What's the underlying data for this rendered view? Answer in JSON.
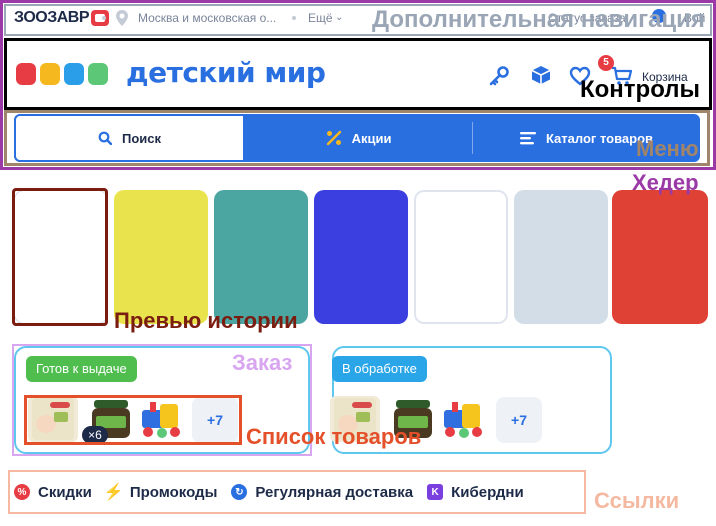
{
  "topbar": {
    "zoo_brand": "ЗООЗАВР",
    "location": "Москва и московская о...",
    "more": "Ещё",
    "right_text": "Статус заказа",
    "user_text": "Вой"
  },
  "header": {
    "brand_name": "детский мир",
    "brand_colors": [
      "#e83c45",
      "#f5b81e",
      "#2a9ee8",
      "#5cc777"
    ],
    "cart_count": "5",
    "cart_label": "Корзина"
  },
  "menu": {
    "items": [
      {
        "label": "Поиск",
        "icon": "search-icon"
      },
      {
        "label": "Акции",
        "icon": "percent-icon"
      },
      {
        "label": "Каталог товаров",
        "icon": "menu-icon"
      }
    ]
  },
  "stories": {
    "colors": [
      "#ffffff",
      "#e9e44e",
      "#4ba6a2",
      "#3c3fe0",
      "#ffffff",
      "#d3dde8",
      "#df4134"
    ]
  },
  "orders": [
    {
      "status": "Готов к выдаче",
      "status_color": "#4fbe4f",
      "qty": "×6",
      "more": "+7"
    },
    {
      "status": "В обработке",
      "status_color": "#2aa6e8",
      "more": "+7"
    }
  ],
  "links": [
    {
      "label": "Скидки",
      "icon": "percent-circle-icon",
      "color": "#e83c45",
      "glyph": "%"
    },
    {
      "label": "Промокоды",
      "icon": "lightning-icon",
      "color": "#f5b81e",
      "glyph": "⚡"
    },
    {
      "label": "Регулярная доставка",
      "icon": "refresh-icon",
      "color": "#2a6fe0",
      "glyph": "↻"
    },
    {
      "label": "Кибердни",
      "icon": "cyber-icon",
      "color": "#7b3fe0",
      "glyph": "K"
    }
  ],
  "annotations": {
    "extra_nav": "Дополнительная навигация",
    "controls": "Контролы",
    "menu": "Меню",
    "header": "Хедер",
    "story_preview": "Превью истории",
    "order": "Заказ",
    "products": "Список товаров",
    "links": "Ссылки",
    "colors": {
      "header": "#9b3aa6",
      "extra_nav": "#9aa6b6",
      "menu": "#a0856a",
      "story": "#7a1d10",
      "order": "#d8a6f0",
      "products": "#e4502a",
      "links": "#f4b9a0"
    }
  }
}
